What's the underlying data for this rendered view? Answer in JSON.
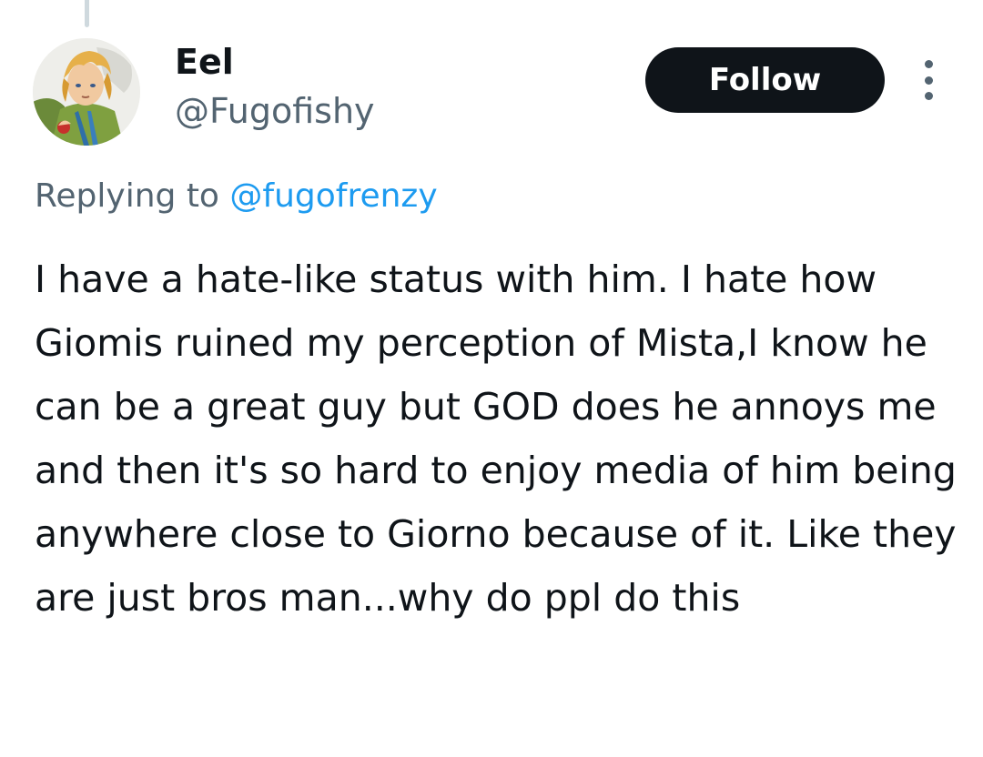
{
  "thread": {
    "has_connector_above": true
  },
  "author": {
    "display_name": "Eel",
    "handle": "@Fugofishy",
    "avatar_icon": "anime-character-avatar"
  },
  "actions": {
    "follow_label": "Follow",
    "more_icon": "more-vertical-icon"
  },
  "reply": {
    "prefix": "Replying to ",
    "mention": "@fugofrenzy"
  },
  "tweet": {
    "text": "I have a hate-like status with him. I hate how Giomis ruined my perception of Mista,I know he can be a great guy but GOD does he annoys me and then it's so hard to enjoy media of him being anywhere close to Giorno because of it. Like they are just bros man...why do ppl do this"
  },
  "colors": {
    "text_primary": "#0f1419",
    "text_secondary": "#536471",
    "link": "#1d9bf0",
    "follow_bg": "#0f1419",
    "follow_text": "#ffffff",
    "thread_line": "#cfd9de"
  }
}
